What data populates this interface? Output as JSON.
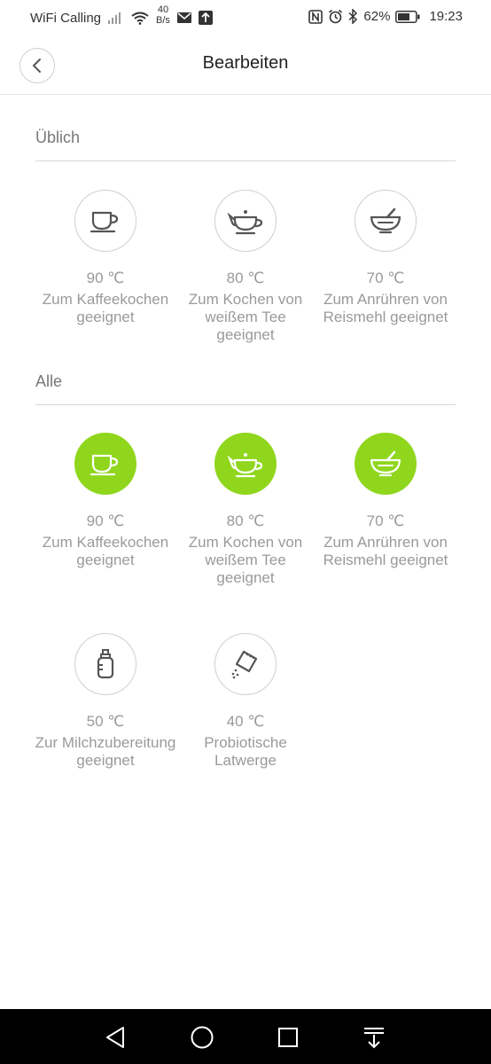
{
  "status_bar": {
    "carrier": "WiFi Calling",
    "netspeed_value": "40",
    "netspeed_unit": "B/s",
    "battery": "62%",
    "time": "19:23"
  },
  "header": {
    "title": "Bearbeiten"
  },
  "sections": {
    "common": {
      "title": "Üblich",
      "items": [
        {
          "temp": "90 ℃",
          "desc": "Zum Kaffeekochen geeignet",
          "icon": "coffee-cup-icon"
        },
        {
          "temp": "80 ℃",
          "desc": "Zum Kochen von weißem Tee geeignet",
          "icon": "teapot-icon"
        },
        {
          "temp": "70 ℃",
          "desc": "Zum Anrühren von Reismehl geeignet",
          "icon": "bowl-icon"
        }
      ]
    },
    "all": {
      "title": "Alle",
      "items": [
        {
          "temp": "90 ℃",
          "desc": "Zum Kaffeekochen geeignet",
          "icon": "coffee-cup-icon"
        },
        {
          "temp": "80 ℃",
          "desc": "Zum Kochen von weißem Tee geeignet",
          "icon": "teapot-icon"
        },
        {
          "temp": "70 ℃",
          "desc": "Zum Anrühren von Reismehl geeignet",
          "icon": "bowl-icon"
        },
        {
          "temp": "50 ℃",
          "desc": "Zur Milchzubereitung geeignet",
          "icon": "baby-bottle-icon"
        },
        {
          "temp": "40 ℃",
          "desc": "Probiotische Latwerge",
          "icon": "sachet-icon"
        }
      ]
    }
  },
  "colors": {
    "accent": "#8fd61d",
    "text_muted": "#9a9a9a",
    "divider": "#d7d7d7"
  }
}
